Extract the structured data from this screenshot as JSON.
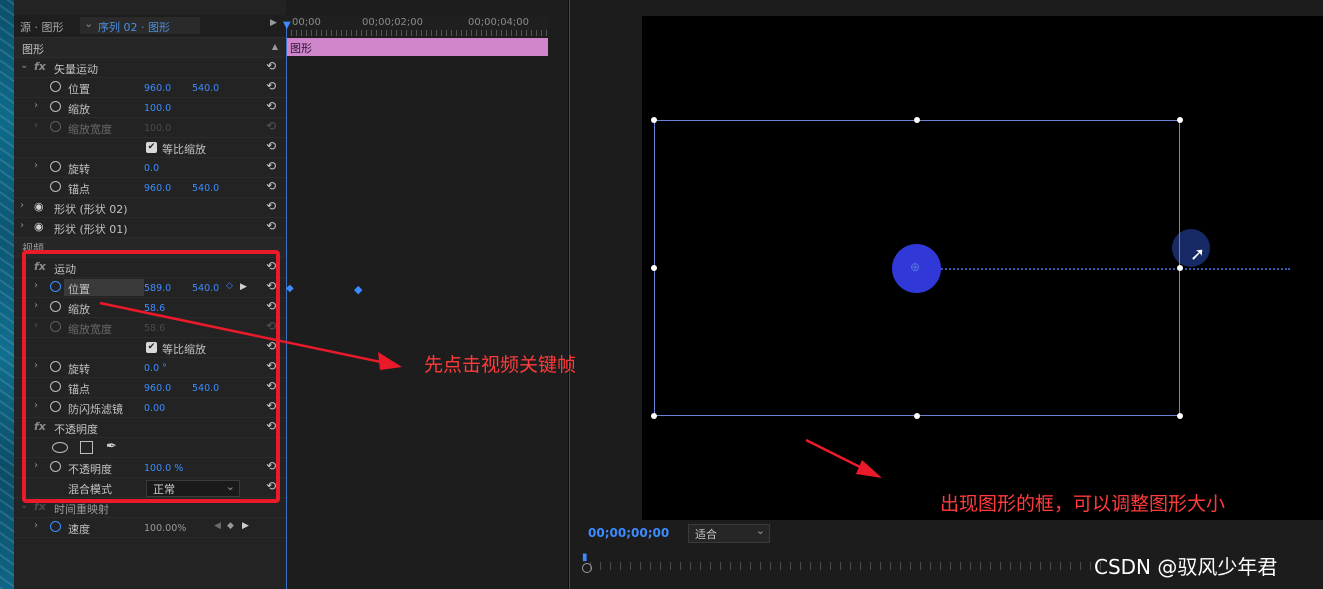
{
  "source_tab": {
    "label": "源 · 图形",
    "sequence": "序列 02 · 图形"
  },
  "ruler": {
    "t0": "00;00",
    "t1": "00;00;02;00",
    "t2": "00;00;04;00"
  },
  "clip_label": "图形",
  "ec": {
    "section_shape": "图形",
    "vector_motion": "矢量运动",
    "v_position": {
      "label": "位置",
      "x": "960.0",
      "y": "540.0"
    },
    "v_scale": {
      "label": "缩放",
      "value": "100.0"
    },
    "v_scale_width": {
      "label": "缩放宽度",
      "value": "100.0"
    },
    "v_uniform": "等比缩放",
    "v_rotation": {
      "label": "旋转",
      "value": "0.0"
    },
    "v_anchor": {
      "label": "锚点",
      "x": "960.0",
      "y": "540.0"
    },
    "shape2": "形状 (形状 02)",
    "shape1": "形状 (形状 01)",
    "section_video": "视频",
    "motion": "运动",
    "m_position": {
      "label": "位置",
      "x": "589.0",
      "y": "540.0"
    },
    "m_scale": {
      "label": "缩放",
      "value": "58.6"
    },
    "m_scale_width": {
      "label": "缩放宽度",
      "value": "58.6"
    },
    "m_uniform": "等比缩放",
    "m_rotation": {
      "label": "旋转",
      "value": "0.0 °"
    },
    "m_anchor": {
      "label": "锚点",
      "x": "960.0",
      "y": "540.0"
    },
    "m_flicker": {
      "label": "防闪烁滤镜",
      "value": "0.00"
    },
    "opacity_fx": "不透明度",
    "opacity": {
      "label": "不透明度",
      "value": "100.0 %"
    },
    "blend": {
      "label": "混合模式",
      "value": "正常"
    },
    "time_remap": "时间重映射",
    "speed": {
      "label": "速度",
      "value": "100.00%"
    }
  },
  "monitor": {
    "timecode": "00;00;00;00",
    "fit": "适合"
  },
  "annotations": {
    "note1": "先点击视频关键帧",
    "note2": "出现图形的框，可以调整图形大小"
  },
  "watermark": "CSDN @驭风少年君",
  "colors": {
    "accent": "#3d8bff",
    "clip": "#cf86cb",
    "annotation": "#ea1a2a"
  }
}
